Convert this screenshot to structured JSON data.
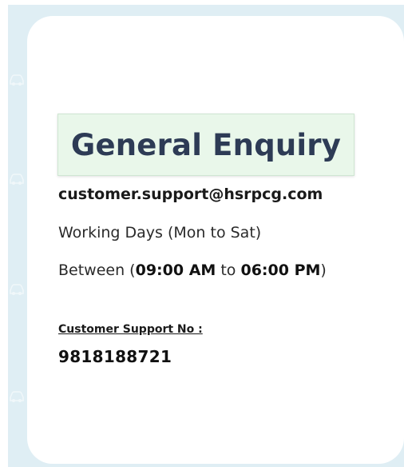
{
  "card": {
    "title": "General Enquiry",
    "email": "customer.support@hsrpcg.com",
    "working_days": "Working Days (Mon to Sat)",
    "hours": {
      "prefix": "Between (",
      "start": "09:00 AM",
      "middle": " to ",
      "end": "06:00 PM",
      "suffix": ")"
    },
    "support_label": "Customer Support No :",
    "support_number": "9818188721"
  },
  "colors": {
    "frame_background": "#dfeef4",
    "card_background": "#ffffff",
    "title_box_background": "#e9f7ea",
    "title_text": "#2d3b55"
  },
  "icons": {
    "background_pattern": "car-icon"
  }
}
